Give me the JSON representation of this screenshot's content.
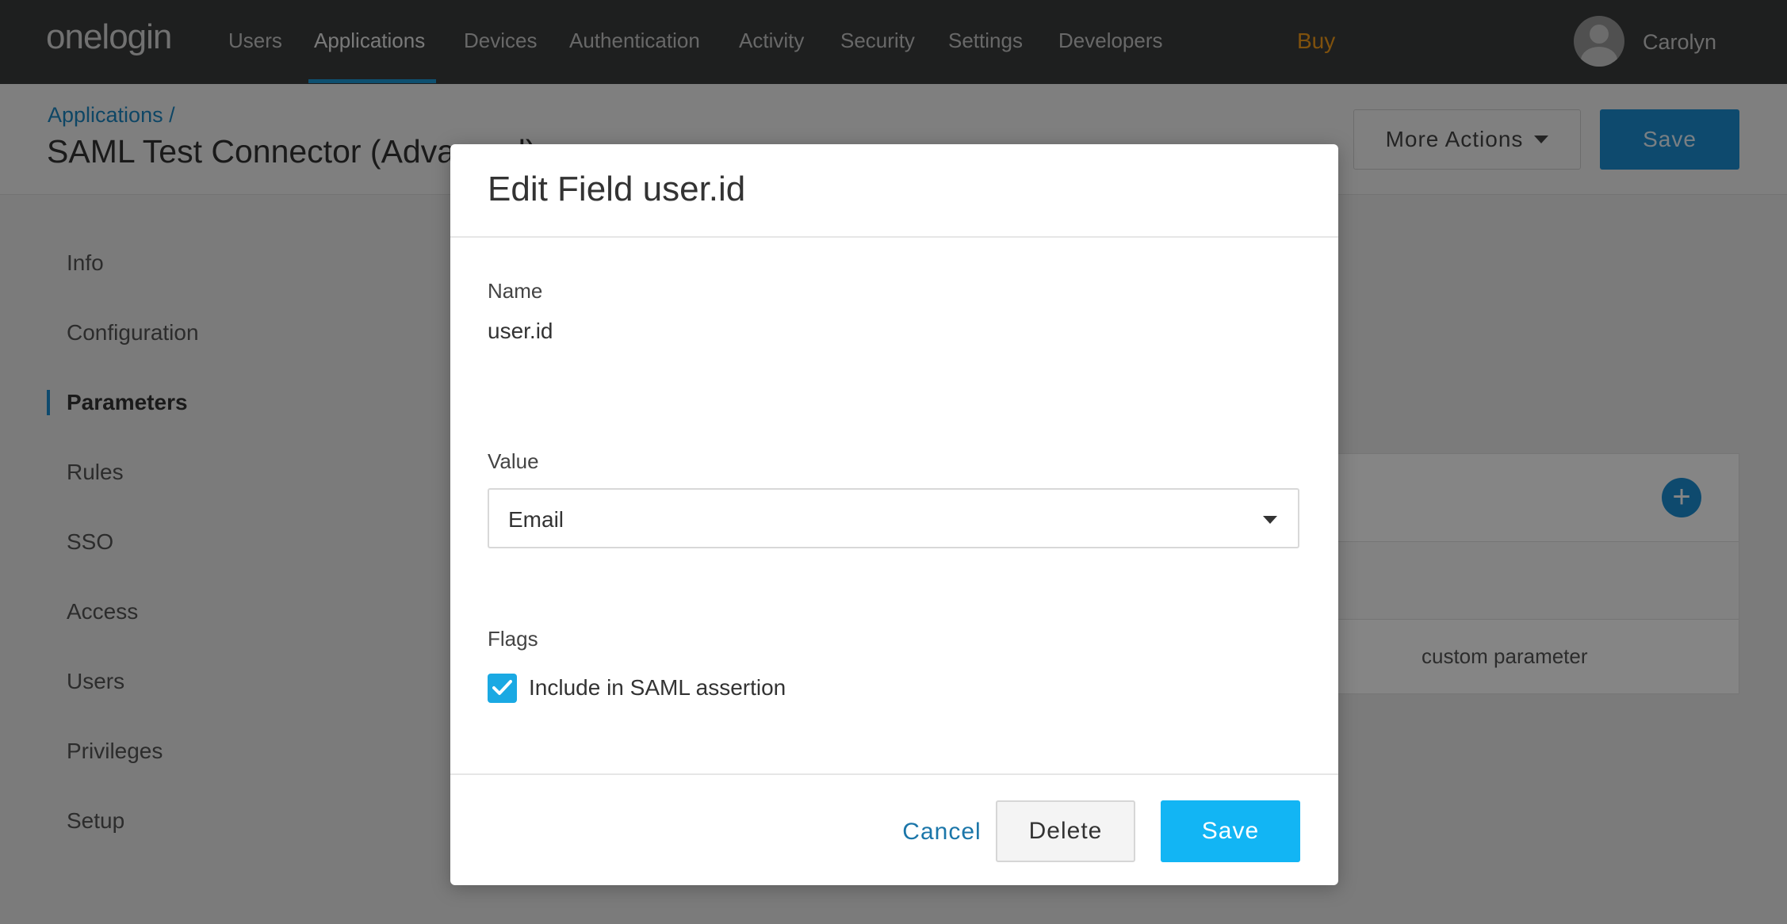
{
  "topbar": {
    "logo": "onelogin",
    "nav": [
      {
        "label": "Users"
      },
      {
        "label": "Applications"
      },
      {
        "label": "Devices"
      },
      {
        "label": "Authentication"
      },
      {
        "label": "Activity"
      },
      {
        "label": "Security"
      },
      {
        "label": "Settings"
      },
      {
        "label": "Developers"
      }
    ],
    "active_nav": "Applications",
    "buy": "Buy",
    "user": "Carolyn"
  },
  "header": {
    "breadcrumb": "Applications /",
    "title": "SAML Test Connector (Advanced)",
    "more_actions": "More Actions",
    "save": "Save"
  },
  "sidebar": {
    "items": [
      {
        "label": "Info"
      },
      {
        "label": "Configuration"
      },
      {
        "label": "Parameters"
      },
      {
        "label": "Rules"
      },
      {
        "label": "SSO"
      },
      {
        "label": "Access"
      },
      {
        "label": "Users"
      },
      {
        "label": "Privileges"
      },
      {
        "label": "Setup"
      }
    ],
    "active": "Parameters"
  },
  "background_table": {
    "row_text": "custom parameter"
  },
  "modal": {
    "title": "Edit Field user.id",
    "name_label": "Name",
    "name_value": "user.id",
    "value_label": "Value",
    "value_selected": "Email",
    "flags_label": "Flags",
    "flag_include_saml": {
      "label": "Include in SAML assertion",
      "checked": true
    },
    "cancel": "Cancel",
    "delete": "Delete",
    "save": "Save"
  },
  "colors": {
    "topbar": "#3a3d3d",
    "accent": "#1c8fd4",
    "buy": "#f49b1a",
    "primary_button": "#12b5f4"
  }
}
